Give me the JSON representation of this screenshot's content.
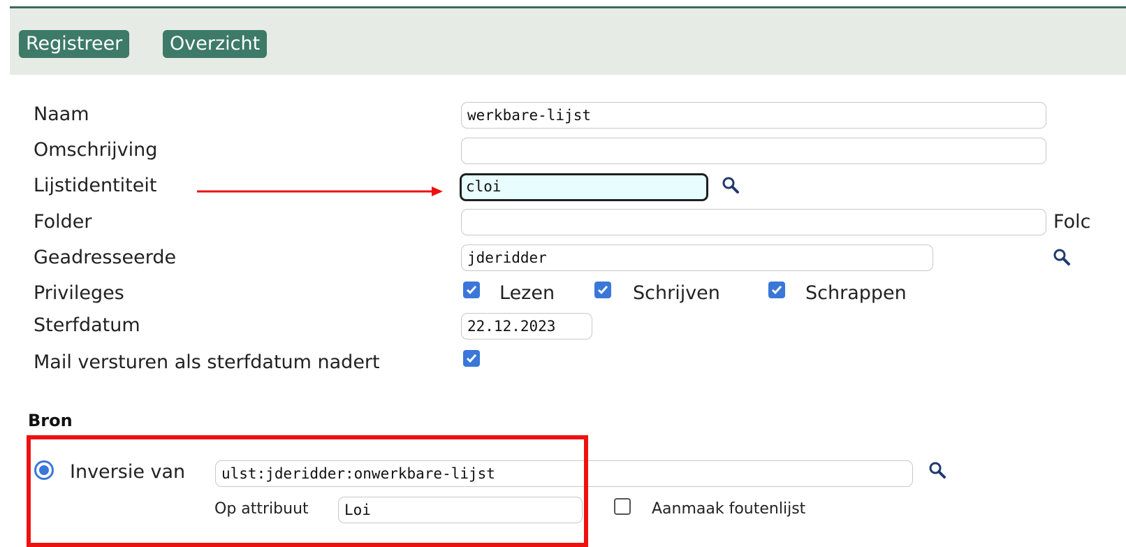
{
  "nav": {
    "register_label": "Registreer",
    "overview_label": "Overzicht"
  },
  "form": {
    "naam": {
      "label": "Naam",
      "value": "werkbare-lijst"
    },
    "omschrijving": {
      "label": "Omschrijving",
      "value": ""
    },
    "lijstidentiteit": {
      "label": "Lijstidentiteit",
      "value": "cloi"
    },
    "folder": {
      "label": "Folder",
      "value": "",
      "side_label": "Folc"
    },
    "geadresseerde": {
      "label": "Geadresseerde",
      "value": "jderidder"
    },
    "privileges": {
      "label": "Privileges",
      "options": [
        {
          "label": "Lezen",
          "checked": true
        },
        {
          "label": "Schrijven",
          "checked": true
        },
        {
          "label": "Schrappen",
          "checked": true
        }
      ]
    },
    "sterfdatum": {
      "label": "Sterfdatum",
      "value": "22.12.2023"
    },
    "mail": {
      "label": "Mail versturen als sterfdatum nadert",
      "checked": true
    }
  },
  "bron": {
    "title": "Bron",
    "inversie_label": "Inversie van",
    "inversie_value": "ulst:jderidder:onwerkbare-lijst",
    "attribuut_label": "Op attribuut",
    "attribuut_value": "Loi",
    "foutenlijst_label": "Aanmaak foutenlijst",
    "foutenlijst_checked": false
  },
  "colors": {
    "accent": "#3d7a68",
    "checkbox": "#3a77d8",
    "annotation": "#ee1111"
  },
  "icons": [
    "search-icon",
    "checkbox-checked-icon",
    "checkbox-empty-icon",
    "radio-selected-icon",
    "arrow-annotation"
  ]
}
